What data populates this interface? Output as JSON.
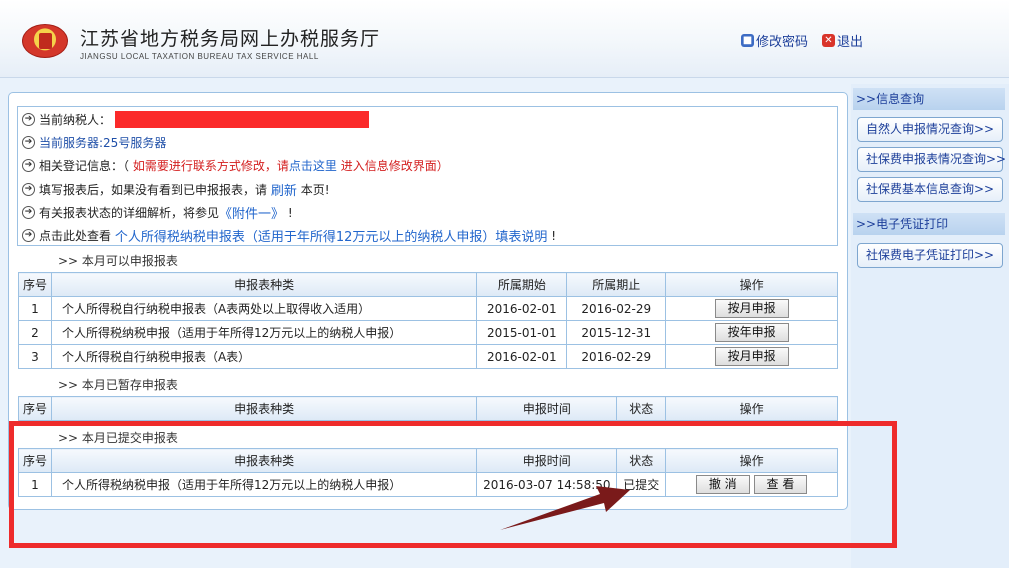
{
  "header": {
    "title_cn": "江苏省地方税务局网上办税服务厅",
    "title_en": "JIANGSU LOCAL TAXATION BUREAU TAX SERVICE HALL",
    "change_password": "修改密码",
    "logout": "退出"
  },
  "info": {
    "taxpayer_label": "当前纳税人：",
    "server": "当前服务器:25号服务器",
    "reg_label": "相关登记信息：（",
    "reg_red_1": "如需要进行联系方式修改，请",
    "reg_click": "点击这里",
    "reg_red_2": "进入信息修改界面）",
    "fill_prefix": "填写报表后，如果没有看到已申报报表，请",
    "refresh": "刷新",
    "fill_suffix": "本页!",
    "detail_prefix": "有关报表状态的详细解析，将参见",
    "attachment": "《附件一》",
    "detail_suffix": "!",
    "click_prefix": "点击此处查看",
    "instructions_link": "个人所得税纳税申报表（适用于年所得12万元以上的纳税人申报）填表说明",
    "click_suffix": "!"
  },
  "sections": {
    "available": ">>   本月可以申报报表",
    "saved": ">>   本月已暂存申报表",
    "submitted": ">>   本月已提交申报表"
  },
  "table_available": {
    "headers": [
      "序号",
      "申报表种类",
      "所属期始",
      "所属期止",
      "操作"
    ],
    "rows": [
      {
        "no": "1",
        "type": "个人所得税自行纳税申报表（A表两处以上取得收入适用）",
        "start": "2016-02-01",
        "end": "2016-02-29",
        "action": "按月申报"
      },
      {
        "no": "2",
        "type": "个人所得税纳税申报（适用于年所得12万元以上的纳税人申报）",
        "start": "2015-01-01",
        "end": "2015-12-31",
        "action": "按年申报"
      },
      {
        "no": "3",
        "type": "个人所得税自行纳税申报表（A表）",
        "start": "2016-02-01",
        "end": "2016-02-29",
        "action": "按月申报"
      }
    ]
  },
  "table_saved": {
    "headers": [
      "序号",
      "申报表种类",
      "申报时间",
      "状态",
      "操作"
    ]
  },
  "table_submitted": {
    "headers": [
      "序号",
      "申报表种类",
      "申报时间",
      "状态",
      "操作"
    ],
    "rows": [
      {
        "no": "1",
        "type": "个人所得税纳税申报（适用于年所得12万元以上的纳税人申报）",
        "time": "2016-03-07 14:58:50",
        "status": "已提交",
        "cancel": "撤 消",
        "view": "查 看"
      }
    ]
  },
  "sidebar": {
    "info_head": ">>信息查询",
    "items": [
      "自然人申报情况查询>>",
      "社保费申报表情况查询>>",
      "社保费基本信息查询>>"
    ],
    "print_head": ">>电子凭证打印",
    "print_items": [
      "社保费电子凭证打印>>"
    ]
  },
  "colors": {
    "annotation_red": "#ee2b2b",
    "arrow": "#7a1a1a",
    "link_blue": "#1f4fa8"
  }
}
